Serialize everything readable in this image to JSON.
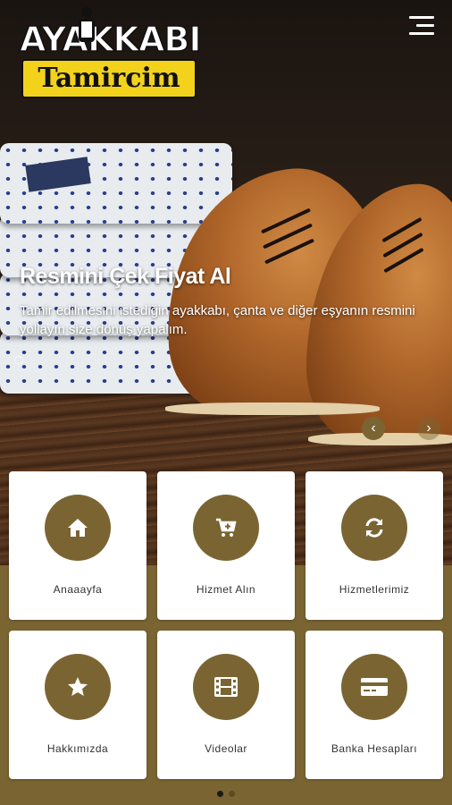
{
  "header": {
    "logo_top": "AYAKKABI",
    "logo_bottom": "Tamircim",
    "menu_icon": "hamburger-icon"
  },
  "slider": {
    "title": "Resmini Çek Fiyat Al",
    "text": "Tamir edilmesini istediğin ayakkabı, çanta ve diğer eşyanın resmini yollayın size dönüş yapalım.",
    "prev_icon": "chevron-left-icon",
    "next_icon": "chevron-right-icon"
  },
  "menu": {
    "items": [
      {
        "label": "Anaaayfa",
        "icon": "home-icon"
      },
      {
        "label": "Hizmet Alın",
        "icon": "cart-plus-icon"
      },
      {
        "label": "Hizmetlerimiz",
        "icon": "refresh-icon"
      },
      {
        "label": "Hakkımızda",
        "icon": "star-icon"
      },
      {
        "label": "Videolar",
        "icon": "film-icon"
      },
      {
        "label": "Banka Hesapları",
        "icon": "credit-card-icon"
      }
    ]
  },
  "pager": {
    "pages": 2,
    "active": 1
  },
  "colors": {
    "accent": "#7a6532",
    "logo_yellow": "#f2d21b"
  }
}
